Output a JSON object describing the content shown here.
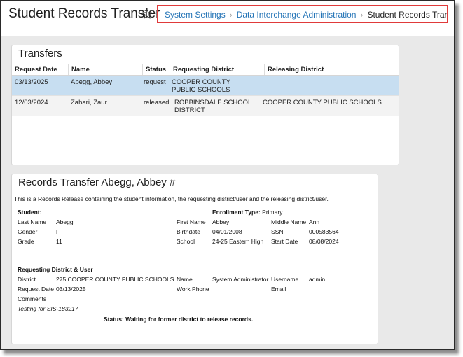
{
  "header": {
    "title": "Student Records Transfer",
    "breadcrumb": [
      {
        "label": "System Settings"
      },
      {
        "label": "Data Interchange Administration"
      },
      {
        "label": "Student Records Transfer"
      }
    ]
  },
  "transfers": {
    "title": "Transfers",
    "columns": [
      "Request Date",
      "Name",
      "Status",
      "Requesting District",
      "Releasing District"
    ],
    "rows": [
      {
        "request_date": "03/13/2025",
        "name": "Abegg, Abbey",
        "status": "request",
        "requesting_district": "COOPER COUNTY PUBLIC SCHOOLS",
        "releasing_district": ""
      },
      {
        "request_date": "12/03/2024",
        "name": "Zahari, Zaur",
        "status": "released",
        "requesting_district": "ROBBINSDALE SCHOOL DISTRICT",
        "releasing_district": "COOPER COUNTY PUBLIC SCHOOLS"
      }
    ]
  },
  "record": {
    "title": "Records Transfer Abegg, Abbey #",
    "intro": "This is a Records Release containing the student information, the requesting district/user and the releasing district/user.",
    "student_heading": "Student:",
    "enrollment_type_label": "Enrollment Type:",
    "enrollment_type": "Primary",
    "last_name_label": "Last Name",
    "last_name": "Abegg",
    "first_name_label": "First Name",
    "first_name": "Abbey",
    "middle_name_label": "Middle Name",
    "middle_name": "Ann",
    "gender_label": "Gender",
    "gender": "F",
    "birthdate_label": "Birthdate",
    "birthdate": "04/01/2008",
    "ssn_label": "SSN",
    "ssn": "000583564",
    "grade_label": "Grade",
    "grade": "11",
    "school_label": "School",
    "school": "24-25 Eastern High",
    "start_date_label": "Start Date",
    "start_date": "08/08/2024",
    "requesting_heading": "Requesting District & User",
    "district_label": "District",
    "district": "275 COOPER COUNTY PUBLIC SCHOOLS",
    "name_label": "Name",
    "name": "System Administrator",
    "username_label": "Username",
    "username": "admin",
    "request_date_label": "Request Date",
    "request_date": "03/13/2025",
    "work_phone_label": "Work Phone",
    "email_label": "Email",
    "comments_label": "Comments",
    "comments": "Testing for SIS-183217",
    "status_text": "Status: Waiting for former district to release records."
  },
  "colors": {
    "accent_link": "#2273b6",
    "highlight_border": "#e03a3a",
    "selected_row": "#c7def1",
    "content_background": "#e9e9e9"
  },
  "icons": [
    "star-icon",
    "chevron-right-icon"
  ]
}
